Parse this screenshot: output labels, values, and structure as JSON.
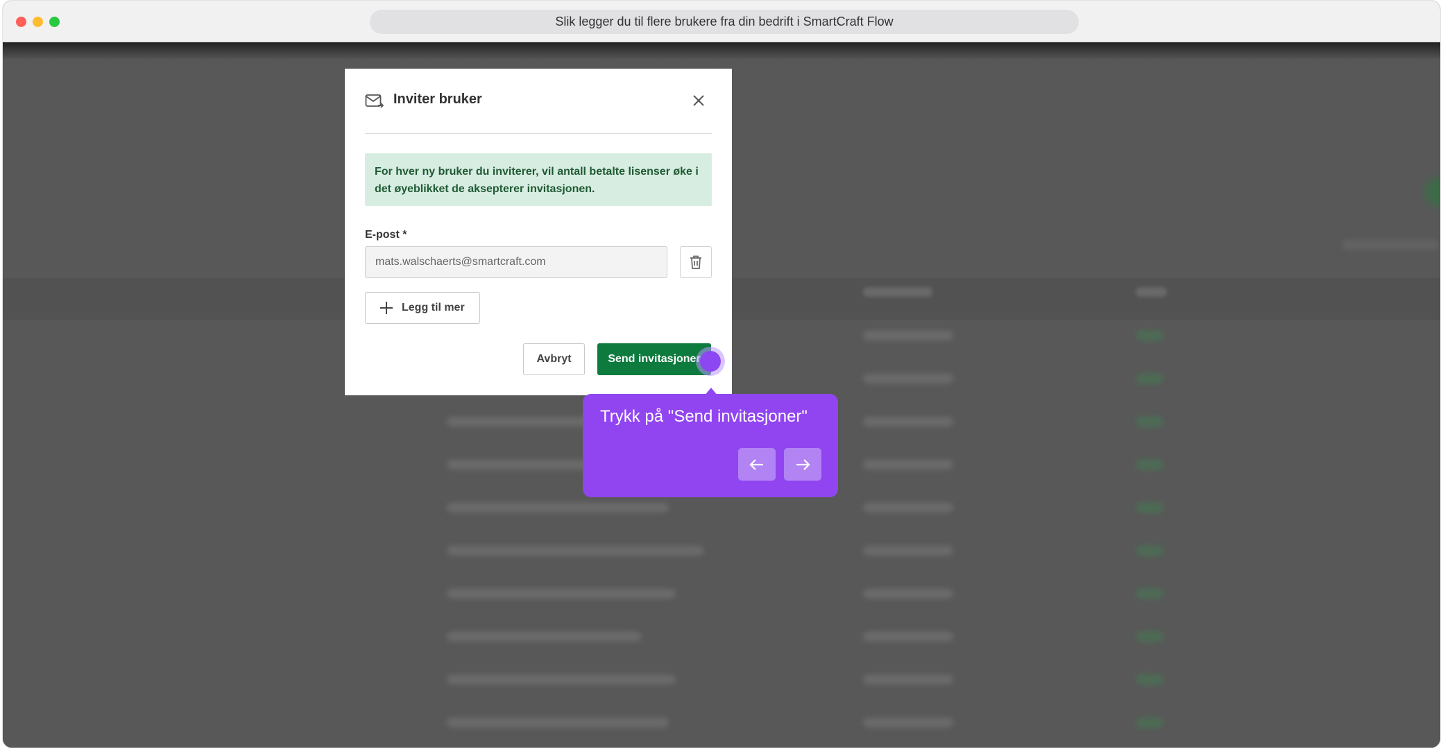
{
  "browser": {
    "title": "Slik legger du til flere brukere fra din bedrift i SmartCraft Flow"
  },
  "modal": {
    "title": "Inviter bruker",
    "info": "For hver ny bruker du inviterer, vil antall betalte lisenser øke i det øyeblikket de aksepterer invitasjonen.",
    "email_label": "E-post *",
    "email_value": "mats.walschaerts@smartcraft.com",
    "add_more_label": "Legg til mer",
    "cancel_label": "Avbryt",
    "send_label": "Send invitasjoner",
    "colors": {
      "primary_green": "#0d7a3e",
      "info_bg": "#d8ede1"
    }
  },
  "tooltip": {
    "text": "Trykk på \"Send invitasjoner\"",
    "prev_icon": "arrow-left-icon",
    "next_icon": "arrow-right-icon",
    "color": "#9145f0"
  }
}
